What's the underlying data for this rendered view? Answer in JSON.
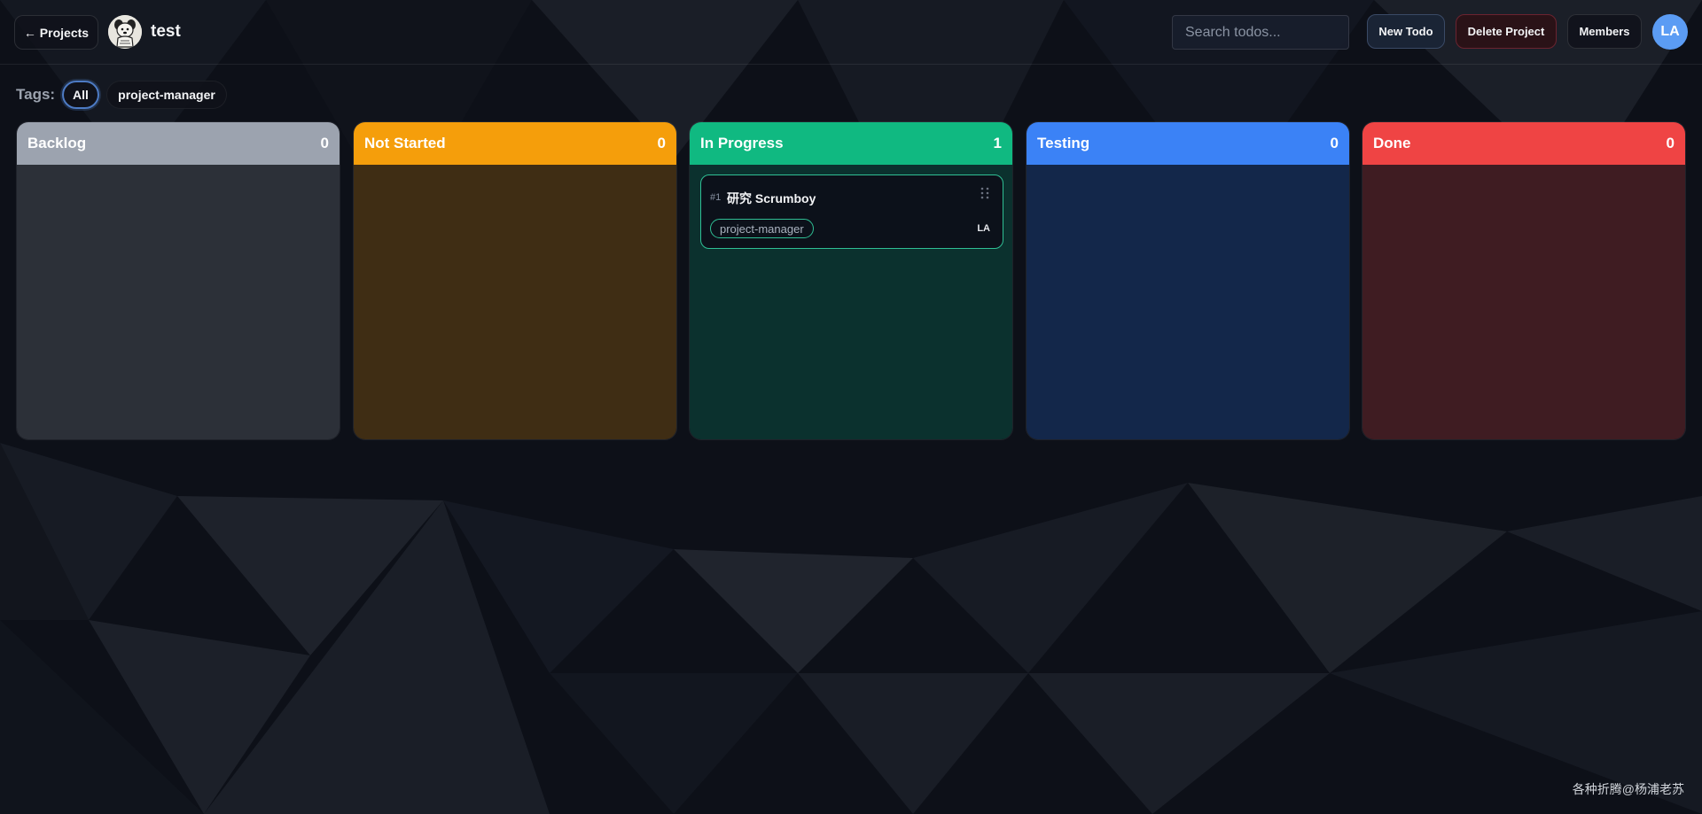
{
  "header": {
    "back_label": "← Projects",
    "project_name": "test",
    "search_placeholder": "Search todos...",
    "new_todo_label": "New Todo",
    "delete_project_label": "Delete Project",
    "members_label": "Members",
    "user_initials": "LA"
  },
  "tags": {
    "label": "Tags:",
    "items": [
      "All",
      "project-manager"
    ],
    "selected": "All"
  },
  "columns": [
    {
      "name": "Backlog",
      "count": "0",
      "color": "#9ca3af"
    },
    {
      "name": "Not Started",
      "count": "0",
      "color": "#f59e0b"
    },
    {
      "name": "In Progress",
      "count": "1",
      "color": "#10b981"
    },
    {
      "name": "Testing",
      "count": "0",
      "color": "#3b82f6"
    },
    {
      "name": "Done",
      "count": "0",
      "color": "#ef4444"
    }
  ],
  "cards": [
    {
      "id": "#1",
      "title": "研究 Scrumboy",
      "tag": "project-manager",
      "assignee": "LA",
      "column": "In Progress"
    }
  ],
  "watermark": "各种折腾@杨浦老苏",
  "icons": {
    "logo": "dog-mascot-icon",
    "drag": "drag-handle-icon"
  }
}
